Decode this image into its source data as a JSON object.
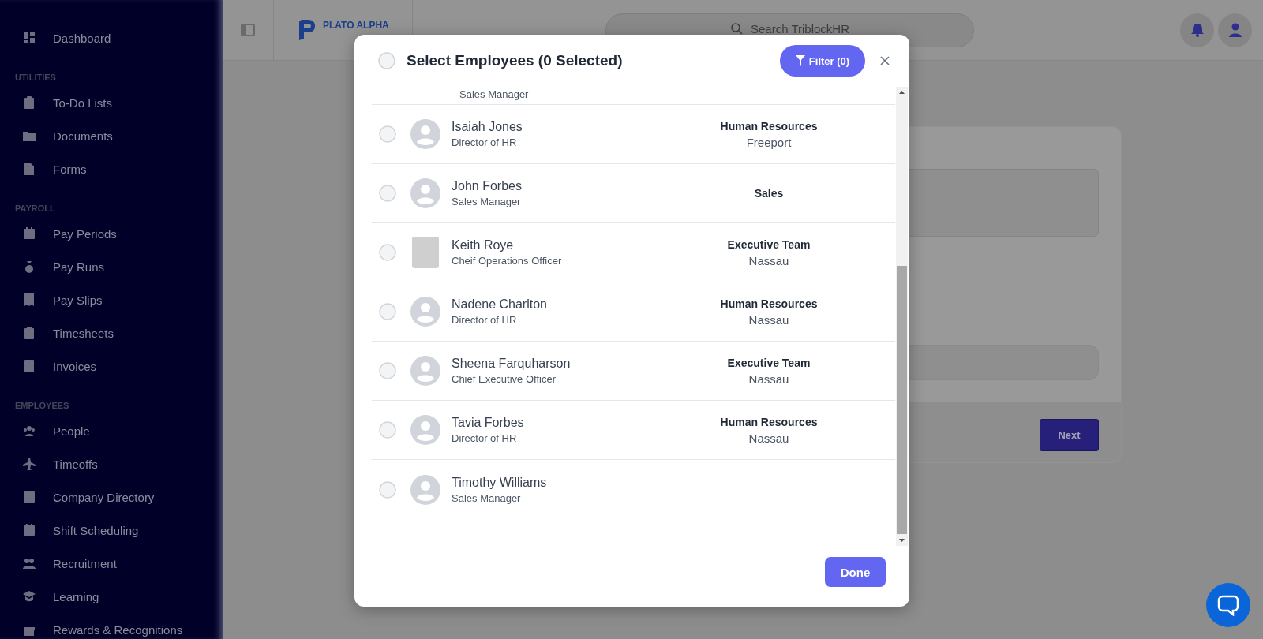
{
  "sidebar": {
    "groups": [
      {
        "items": [
          {
            "label": "Dashboard"
          }
        ]
      },
      {
        "heading": "UTILITIES",
        "items": [
          {
            "label": "To-Do Lists"
          },
          {
            "label": "Documents"
          },
          {
            "label": "Forms"
          }
        ]
      },
      {
        "heading": "PAYROLL",
        "items": [
          {
            "label": "Pay Periods"
          },
          {
            "label": "Pay Runs"
          },
          {
            "label": "Pay Slips"
          },
          {
            "label": "Timesheets"
          },
          {
            "label": "Invoices"
          }
        ]
      },
      {
        "heading": "EMPLOYEES",
        "items": [
          {
            "label": "People"
          },
          {
            "label": "Timeoffs"
          },
          {
            "label": "Company Directory"
          },
          {
            "label": "Shift Scheduling"
          },
          {
            "label": "Recruitment"
          },
          {
            "label": "Learning"
          },
          {
            "label": "Rewards & Recognitions"
          }
        ]
      }
    ]
  },
  "header": {
    "logo_text": "PLATO ALPHA",
    "search_placeholder": "Search TriblockHR"
  },
  "form_card": {
    "next_button": "Next"
  },
  "modal": {
    "title": "Select Employees (0 Selected)",
    "select_all_checked": false,
    "filter_button": "Filter (0)",
    "rows": [
      {
        "job_title": "Sales Manager"
      },
      {
        "kind": "placeholder",
        "name": "Isaiah Jones",
        "job_title": "Director of HR",
        "department": "Human Resources",
        "location": "Freeport",
        "checked": false
      },
      {
        "kind": "placeholder",
        "name": "John Forbes",
        "job_title": "Sales Manager",
        "department": "Sales",
        "checked": false
      },
      {
        "kind": "photo",
        "name": "Keith Roye",
        "job_title": "Cheif Operations Officer",
        "department": "Executive Team",
        "location": "Nassau",
        "checked": false
      },
      {
        "kind": "placeholder",
        "name": "Nadene Charlton",
        "job_title": "Director of HR",
        "department": "Human Resources",
        "location": "Nassau",
        "checked": false
      },
      {
        "kind": "placeholder",
        "name": "Sheena Farquharson",
        "job_title": "Chief Executive Officer",
        "department": "Executive Team",
        "location": "Nassau",
        "checked": false
      },
      {
        "kind": "placeholder",
        "name": "Tavia Forbes",
        "job_title": "Director of HR",
        "department": "Human Resources",
        "location": "Nassau",
        "checked": false
      },
      {
        "kind": "placeholder",
        "name": "Timothy Williams",
        "job_title": "Sales Manager",
        "checked": false
      }
    ],
    "done_button": "Done"
  }
}
